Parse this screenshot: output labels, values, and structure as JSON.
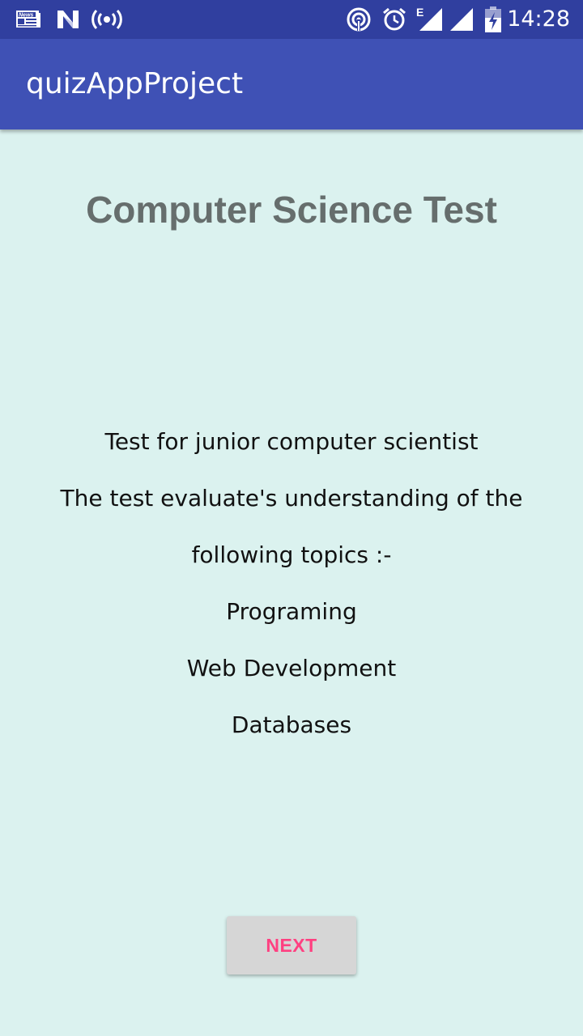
{
  "status_bar": {
    "time": "14:28",
    "network_label": "E",
    "icons": [
      "news-icon",
      "n-notification-icon",
      "hotspot-broadcast-icon",
      "nfc-icon",
      "alarm-icon",
      "mobile-signal-icon",
      "wifi-signal-icon",
      "battery-charging-icon"
    ]
  },
  "app_bar": {
    "title": "quizAppProject"
  },
  "main": {
    "heading": "Computer Science Test",
    "description_lines": [
      "Test for junior computer scientist",
      "The test evaluate's understanding of the",
      "following topics :-",
      "Programing",
      "Web Development",
      "Databases"
    ],
    "next_button_label": "NEXT"
  },
  "colors": {
    "status_bar": "#303f9f",
    "app_bar": "#3f51b5",
    "background": "#dbf2ef",
    "heading": "#666e6d",
    "button_text": "#ff4081",
    "button_bg": "#d6d6d6"
  }
}
